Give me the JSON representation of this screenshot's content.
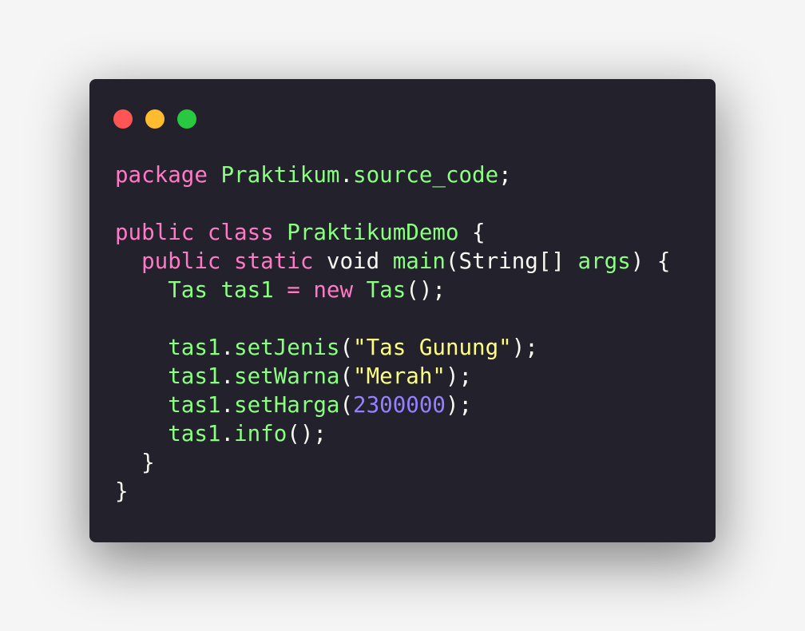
{
  "colors": {
    "background": "#f5f5f5",
    "window": "#22212c",
    "close": "#ff5555",
    "minimize": "#ffbc2e",
    "maximize": "#28c840",
    "keyword": "#ff79c6",
    "identifier": "#8aff80",
    "plain": "#f8f8f2",
    "string": "#ffff80",
    "number": "#9580ff"
  },
  "window_controls": [
    {
      "name": "close-icon",
      "color": "#ff5555"
    },
    {
      "name": "minimize-icon",
      "color": "#ffbc2e"
    },
    {
      "name": "maximize-icon",
      "color": "#28c840"
    }
  ],
  "code_lines": [
    [
      {
        "t": "package",
        "k": "keyword"
      },
      {
        "t": " ",
        "k": "plain"
      },
      {
        "t": "Praktikum",
        "k": "identifier"
      },
      {
        "t": ".",
        "k": "plain"
      },
      {
        "t": "source_code",
        "k": "identifier"
      },
      {
        "t": ";",
        "k": "plain"
      }
    ],
    [],
    [
      {
        "t": "public",
        "k": "keyword"
      },
      {
        "t": " ",
        "k": "plain"
      },
      {
        "t": "class",
        "k": "keyword"
      },
      {
        "t": " ",
        "k": "plain"
      },
      {
        "t": "PraktikumDemo",
        "k": "identifier"
      },
      {
        "t": " {",
        "k": "plain"
      }
    ],
    [
      {
        "t": "  ",
        "k": "plain"
      },
      {
        "t": "public",
        "k": "keyword"
      },
      {
        "t": " ",
        "k": "plain"
      },
      {
        "t": "static",
        "k": "keyword"
      },
      {
        "t": " void ",
        "k": "plain"
      },
      {
        "t": "main",
        "k": "identifier"
      },
      {
        "t": "(String[] ",
        "k": "plain"
      },
      {
        "t": "args",
        "k": "identifier"
      },
      {
        "t": ") {",
        "k": "plain"
      }
    ],
    [
      {
        "t": "    ",
        "k": "plain"
      },
      {
        "t": "Tas tas1",
        "k": "identifier"
      },
      {
        "t": " ",
        "k": "plain"
      },
      {
        "t": "=",
        "k": "keyword"
      },
      {
        "t": " ",
        "k": "plain"
      },
      {
        "t": "new",
        "k": "keyword"
      },
      {
        "t": " ",
        "k": "plain"
      },
      {
        "t": "Tas",
        "k": "identifier"
      },
      {
        "t": "();",
        "k": "plain"
      }
    ],
    [],
    [
      {
        "t": "    ",
        "k": "plain"
      },
      {
        "t": "tas1",
        "k": "identifier"
      },
      {
        "t": ".",
        "k": "plain"
      },
      {
        "t": "setJenis",
        "k": "identifier"
      },
      {
        "t": "(",
        "k": "plain"
      },
      {
        "t": "\"Tas Gunung\"",
        "k": "string"
      },
      {
        "t": ");",
        "k": "plain"
      }
    ],
    [
      {
        "t": "    ",
        "k": "plain"
      },
      {
        "t": "tas1",
        "k": "identifier"
      },
      {
        "t": ".",
        "k": "plain"
      },
      {
        "t": "setWarna",
        "k": "identifier"
      },
      {
        "t": "(",
        "k": "plain"
      },
      {
        "t": "\"Merah\"",
        "k": "string"
      },
      {
        "t": ");",
        "k": "plain"
      }
    ],
    [
      {
        "t": "    ",
        "k": "plain"
      },
      {
        "t": "tas1",
        "k": "identifier"
      },
      {
        "t": ".",
        "k": "plain"
      },
      {
        "t": "setHarga",
        "k": "identifier"
      },
      {
        "t": "(",
        "k": "plain"
      },
      {
        "t": "2300000",
        "k": "number"
      },
      {
        "t": ");",
        "k": "plain"
      }
    ],
    [
      {
        "t": "    ",
        "k": "plain"
      },
      {
        "t": "tas1",
        "k": "identifier"
      },
      {
        "t": ".",
        "k": "plain"
      },
      {
        "t": "info",
        "k": "identifier"
      },
      {
        "t": "();",
        "k": "plain"
      }
    ],
    [
      {
        "t": "  }",
        "k": "plain"
      }
    ],
    [
      {
        "t": "}",
        "k": "plain"
      }
    ]
  ]
}
